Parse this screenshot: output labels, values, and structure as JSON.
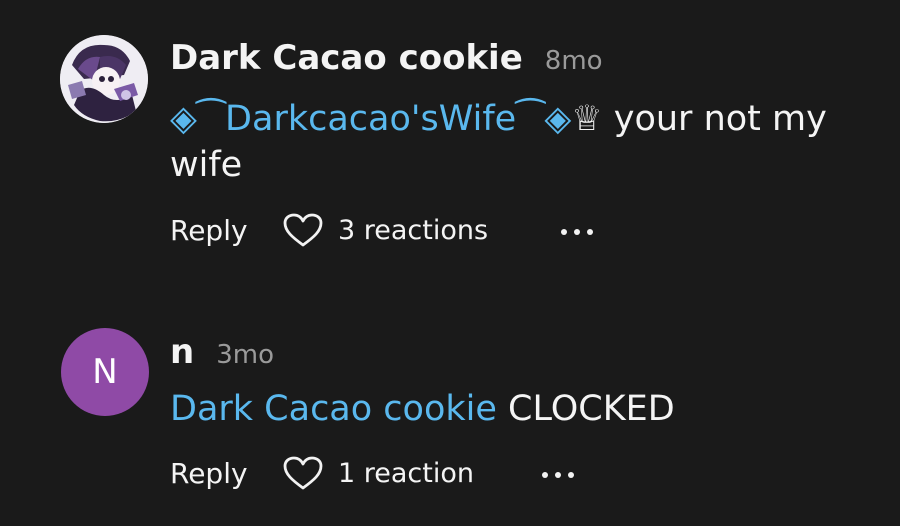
{
  "comments": [
    {
      "author": "Dark Cacao cookie",
      "time": "8mo",
      "avatar": "character-art-avatar",
      "mention_prefix": "◈⁀",
      "mention": "Darkcacao'sWife",
      "mention_suffix": "⁀◈",
      "crown": "♕",
      "text": " your not my wife",
      "reply_label": "Reply",
      "reactions_label": "3 reactions",
      "more_icon": "ellipsis-icon"
    },
    {
      "author": "n",
      "time": "3mo",
      "avatar_letter": "N",
      "avatar_color": "#8f4aa6",
      "mention": "Dark Cacao cookie",
      "text": " CLOCKED",
      "reply_label": "Reply",
      "reactions_label": "1 reaction",
      "more_icon": "ellipsis-icon"
    }
  ],
  "colors": {
    "background": "#1a1a1a",
    "mention": "#5ab8ee",
    "timestamp": "#9a9a9a"
  }
}
